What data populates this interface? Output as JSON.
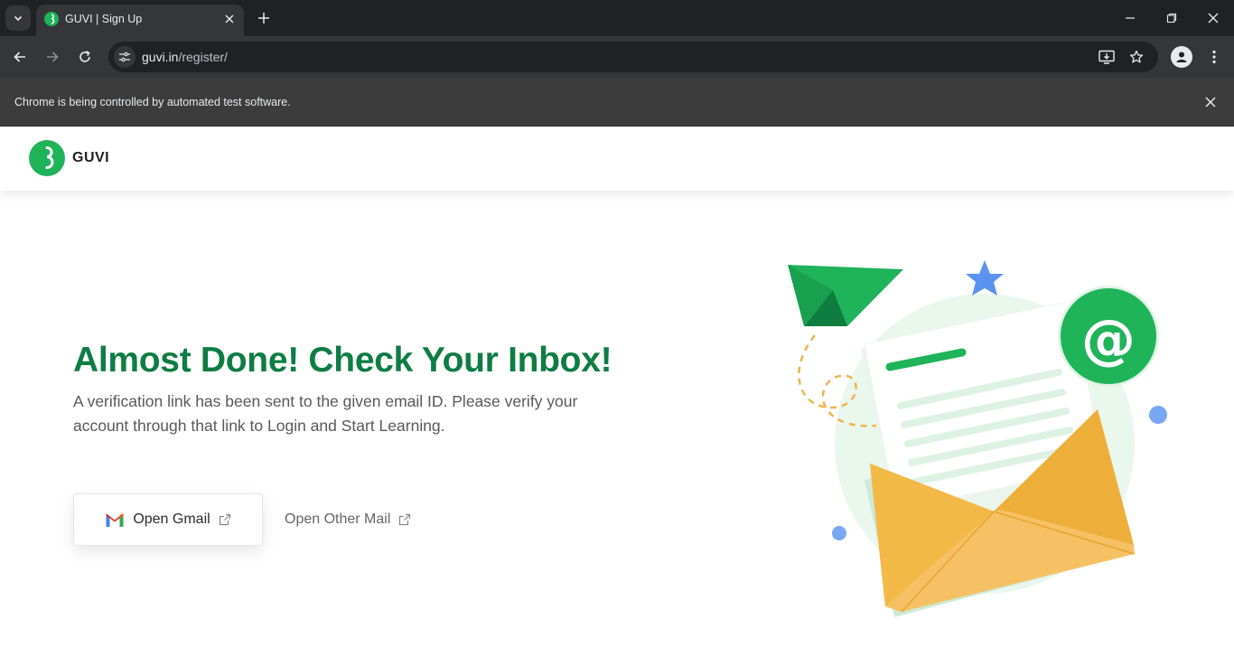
{
  "browser": {
    "tab_title": "GUVI | Sign Up",
    "url_host": "guvi.in",
    "url_path": "/register/",
    "infobar_text": "Chrome is being controlled by automated test software."
  },
  "site": {
    "brand_name": "GUVI",
    "headline": "Almost Done! Check Your Inbox!",
    "subtext": "A verification link has been sent to the given email ID. Please verify your account through that link to Login and Start Learning.",
    "gmail_button_label": "Open Gmail",
    "other_mail_label": "Open Other Mail"
  },
  "colors": {
    "brand_green": "#1fb35a",
    "headline_green": "#0e7d44",
    "envelope_orange": "#f2b544"
  },
  "icons": [
    "tab-search-icon",
    "close-icon",
    "new-tab-icon",
    "back-icon",
    "forward-icon",
    "reload-icon",
    "install-app-icon",
    "star-icon",
    "profile-icon",
    "menu-icon",
    "gmail-icon",
    "external-link-icon"
  ]
}
